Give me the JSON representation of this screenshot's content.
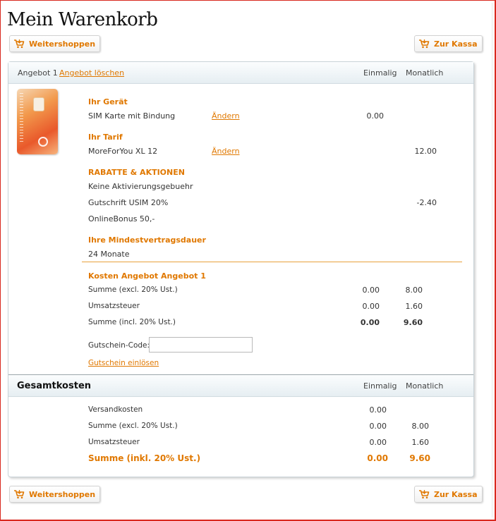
{
  "page": {
    "title": "Mein Warenkorb"
  },
  "buttons": {
    "continue_shopping": "Weitershoppen",
    "checkout": "Zur Kassa"
  },
  "offer": {
    "header_label": "Angebot 1",
    "delete_link": "Angebot löschen",
    "col_once": "Einmalig",
    "col_monthly": "Monatlich",
    "device": {
      "heading": "Ihr Gerät",
      "name": "SIM Karte mit Bindung",
      "change": "Ändern",
      "once": "0.00"
    },
    "tariff": {
      "heading": "Ihr Tarif",
      "name": "MoreForYou XL 12",
      "change": "Ändern",
      "monthly": "12.00"
    },
    "discounts": {
      "heading": "RABATTE & AKTIONEN",
      "items": [
        {
          "label": "Keine Aktivierungsgebuehr",
          "monthly": ""
        },
        {
          "label": "Gutschrift USIM 20%",
          "monthly": "-2.40"
        },
        {
          "label": "OnlineBonus 50,-",
          "monthly": ""
        }
      ]
    },
    "duration": {
      "heading": "Ihre Mindestvertragsdauer",
      "value": "24 Monate"
    },
    "costs": {
      "heading": "Kosten Angebot Angebot 1",
      "rows": [
        {
          "label": "Summe (excl. 20% Ust.)",
          "once": "0.00",
          "monthly": "8.00"
        },
        {
          "label": "Umsatzsteuer",
          "once": "0.00",
          "monthly": "1.60"
        },
        {
          "label": "Summe (incl. 20% Ust.)",
          "once": "0.00",
          "monthly": "9.60"
        }
      ]
    },
    "voucher": {
      "label": "Gutschein-Code:",
      "value": "",
      "placeholder": "",
      "redeem": "Gutschein einlösen"
    }
  },
  "total": {
    "title": "Gesamtkosten",
    "col_once": "Einmalig",
    "col_monthly": "Monatlich",
    "rows": [
      {
        "label": "Versandkosten",
        "once": "0.00",
        "monthly": ""
      },
      {
        "label": "Summe (excl. 20% Ust.)",
        "once": "0.00",
        "monthly": "8.00"
      },
      {
        "label": "Umsatzsteuer",
        "once": "0.00",
        "monthly": "1.60"
      },
      {
        "label": "Summe (inkl. 20% Ust.)",
        "once": "0.00",
        "monthly": "9.60"
      }
    ]
  },
  "colors": {
    "accent": "#e07800",
    "frame": "#d9281e",
    "header_bg": "#e6eef2"
  }
}
